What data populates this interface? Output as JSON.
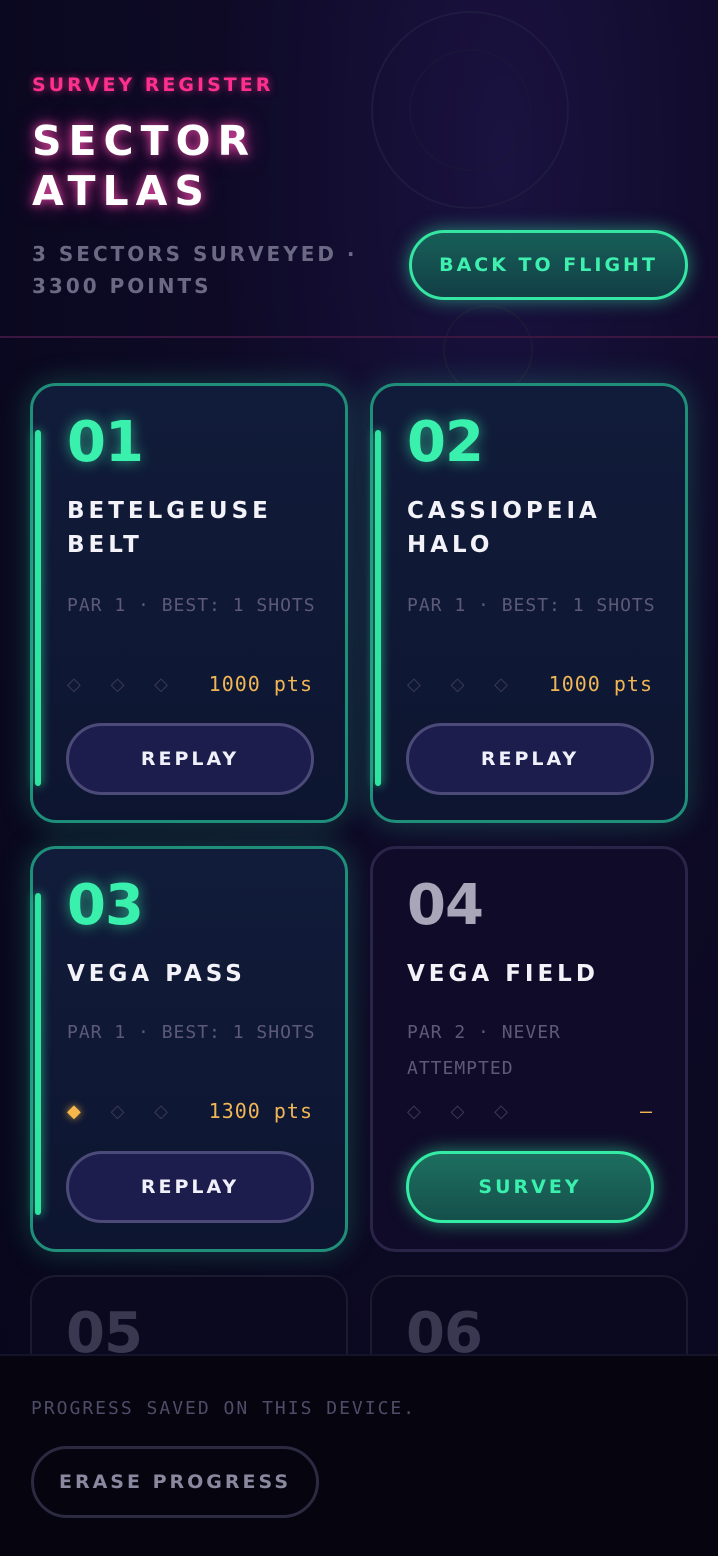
{
  "header": {
    "eyebrow": "SURVEY REGISTER",
    "title": "SECTOR ATLAS",
    "subtitle": "3 SECTORS SURVEYED · 3300 POINTS",
    "back_label": "BACK TO FLIGHT"
  },
  "sectors": [
    {
      "number": "01",
      "name": "BETELGEUSE BELT",
      "info": "PAR 1 · BEST: 1 SHOTS",
      "stars": "◇ ◇ ◇",
      "points": "1000 pts",
      "action": "REPLAY"
    },
    {
      "number": "02",
      "name": "CASSIOPEIA HALO",
      "info": "PAR 1 · BEST: 1 SHOTS",
      "stars": "◇ ◇ ◇",
      "points": "1000 pts",
      "action": "REPLAY"
    },
    {
      "number": "03",
      "name": "VEGA PASS",
      "info": "PAR 1 · BEST: 1 SHOTS",
      "star_on": "◆",
      "stars": "◇ ◇",
      "points": "1300 pts",
      "action": "REPLAY"
    },
    {
      "number": "04",
      "name": "VEGA FIELD",
      "info": "PAR 2 · NEVER ATTEMPTED",
      "stars": "◇ ◇ ◇",
      "points": "—",
      "action": "SURVEY"
    },
    {
      "number": "05"
    },
    {
      "number": "06"
    }
  ],
  "footer": {
    "note": "PROGRESS SAVED ON THIS DEVICE.",
    "erase_label": "ERASE PROGRESS"
  },
  "colors": {
    "accent_green": "#34e6a2",
    "accent_pink": "#ff2f8e",
    "gold": "#f0b656"
  }
}
